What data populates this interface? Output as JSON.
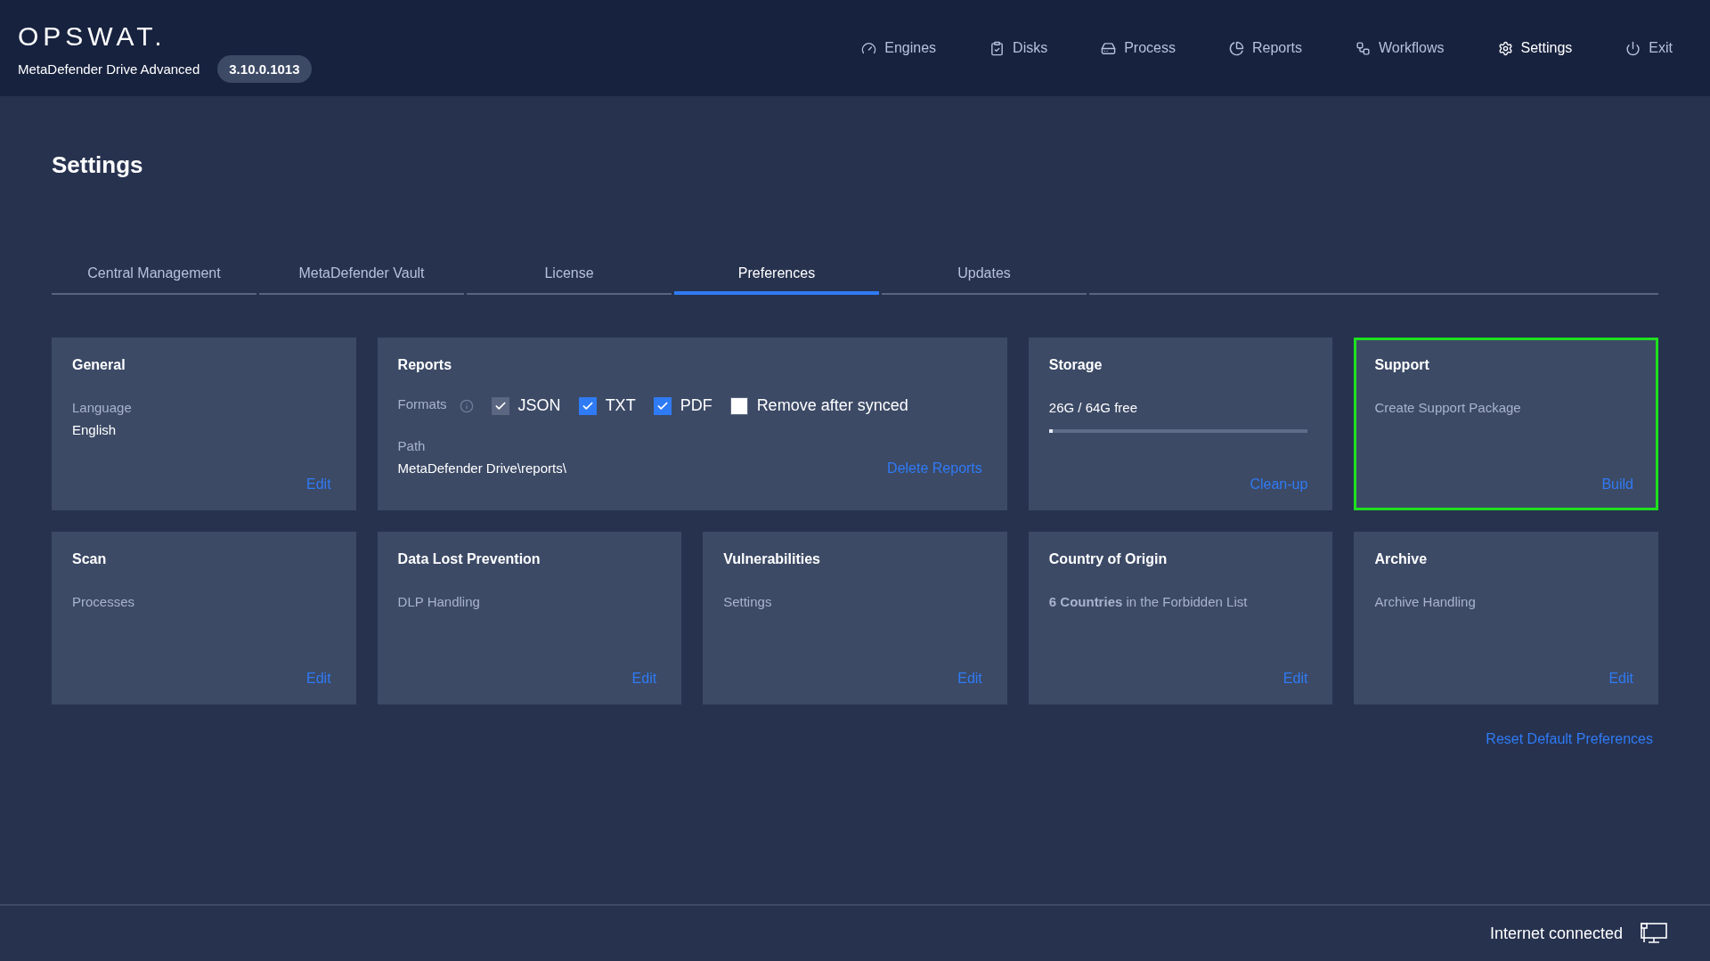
{
  "header": {
    "logo": "OPSWAT.",
    "product": "MetaDefender Drive Advanced",
    "version": "3.10.0.1013"
  },
  "nav": [
    {
      "kind": "engines",
      "label": "Engines",
      "selected": false
    },
    {
      "kind": "disks",
      "label": "Disks",
      "selected": false
    },
    {
      "kind": "process",
      "label": "Process",
      "selected": false
    },
    {
      "kind": "reports",
      "label": "Reports",
      "selected": false
    },
    {
      "kind": "workflows",
      "label": "Workflows",
      "selected": false
    },
    {
      "kind": "settings",
      "label": "Settings",
      "selected": true
    },
    {
      "kind": "exit",
      "label": "Exit",
      "selected": false
    }
  ],
  "page_title": "Settings",
  "tabs": [
    {
      "label": "Central Management",
      "selected": false
    },
    {
      "label": "MetaDefender Vault",
      "selected": false
    },
    {
      "label": "License",
      "selected": false
    },
    {
      "label": "Preferences",
      "selected": true
    },
    {
      "label": "Updates",
      "selected": false
    }
  ],
  "cards": [
    {
      "kind": "field",
      "title": "General",
      "label": "Language",
      "value": "English",
      "action": "Edit",
      "highlighted": false
    },
    {
      "kind": "formats",
      "title": "Reports",
      "label": "Formats",
      "options": [
        {
          "label": "JSON",
          "checked": true,
          "disabled": true
        },
        {
          "label": "TXT",
          "checked": true,
          "disabled": false
        },
        {
          "label": "PDF",
          "checked": true,
          "disabled": false
        },
        {
          "label": "Remove after synced",
          "checked": false,
          "disabled": false
        }
      ],
      "path_label": "Path",
      "value": "MetaDefender Drive\\reports\\",
      "action": "Delete Reports",
      "highlighted": false
    },
    {
      "kind": "meter",
      "title": "Storage",
      "reading": "26G / 64G free",
      "level": 0.01,
      "action": "Clean-up",
      "highlighted": false
    },
    {
      "kind": "text",
      "title": "Support",
      "label": "Create Support Package",
      "action": "Build",
      "highlighted": true
    },
    {
      "kind": "text",
      "title": "Scan",
      "label": "Processes",
      "action": "Edit",
      "highlighted": false
    },
    {
      "kind": "text",
      "title": "Data Lost Prevention",
      "label": "DLP Handling",
      "action": "Edit",
      "highlighted": false
    },
    {
      "kind": "text",
      "title": "Vulnerabilities",
      "label": "Settings",
      "action": "Edit",
      "highlighted": false
    },
    {
      "kind": "text",
      "title": "Country of Origin",
      "label": "**6 Countries** in the Forbidden List",
      "action": "Edit",
      "highlighted": false
    },
    {
      "kind": "text",
      "title": "Archive",
      "label": "Archive Handling",
      "action": "Edit",
      "highlighted": false
    }
  ],
  "reset_link": "Reset Default Preferences",
  "status_bar": {
    "text": "Internet connected"
  }
}
